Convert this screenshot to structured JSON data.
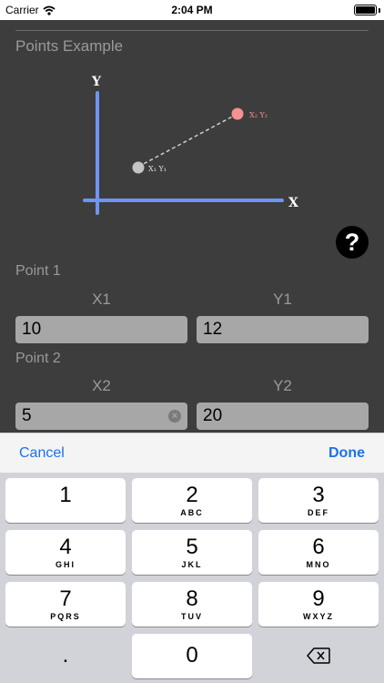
{
  "status_bar": {
    "carrier": "Carrier",
    "time": "2:04 PM"
  },
  "section_title": "Points Example",
  "diagram": {
    "y_axis_label": "Y",
    "x_axis_label": "X",
    "point1_label": "X₁ Y₁",
    "point2_label": "X₂ Y₂",
    "colors": {
      "axis": "#6f94f5",
      "point1": "#c4c4c4",
      "point2": "#f79090",
      "dash": "#cfcfcf"
    }
  },
  "help_button": {
    "label": "?"
  },
  "point1": {
    "title": "Point 1",
    "x_label": "X1",
    "y_label": "Y1",
    "x_value": "10",
    "y_value": "12"
  },
  "point2": {
    "title": "Point 2",
    "x_label": "X2",
    "y_label": "Y2",
    "x_value": "5",
    "y_value": "20"
  },
  "accessory": {
    "cancel": "Cancel",
    "done": "Done"
  },
  "keyboard": {
    "keys": [
      {
        "num": "1",
        "letters": ""
      },
      {
        "num": "2",
        "letters": "ABC"
      },
      {
        "num": "3",
        "letters": "DEF"
      },
      {
        "num": "4",
        "letters": "GHI"
      },
      {
        "num": "5",
        "letters": "JKL"
      },
      {
        "num": "6",
        "letters": "MNO"
      },
      {
        "num": "7",
        "letters": "PQRS"
      },
      {
        "num": "8",
        "letters": "TUV"
      },
      {
        "num": "9",
        "letters": "WXYZ"
      }
    ],
    "dot": ".",
    "zero": "0",
    "delete_icon": "delete-backspace-icon"
  }
}
